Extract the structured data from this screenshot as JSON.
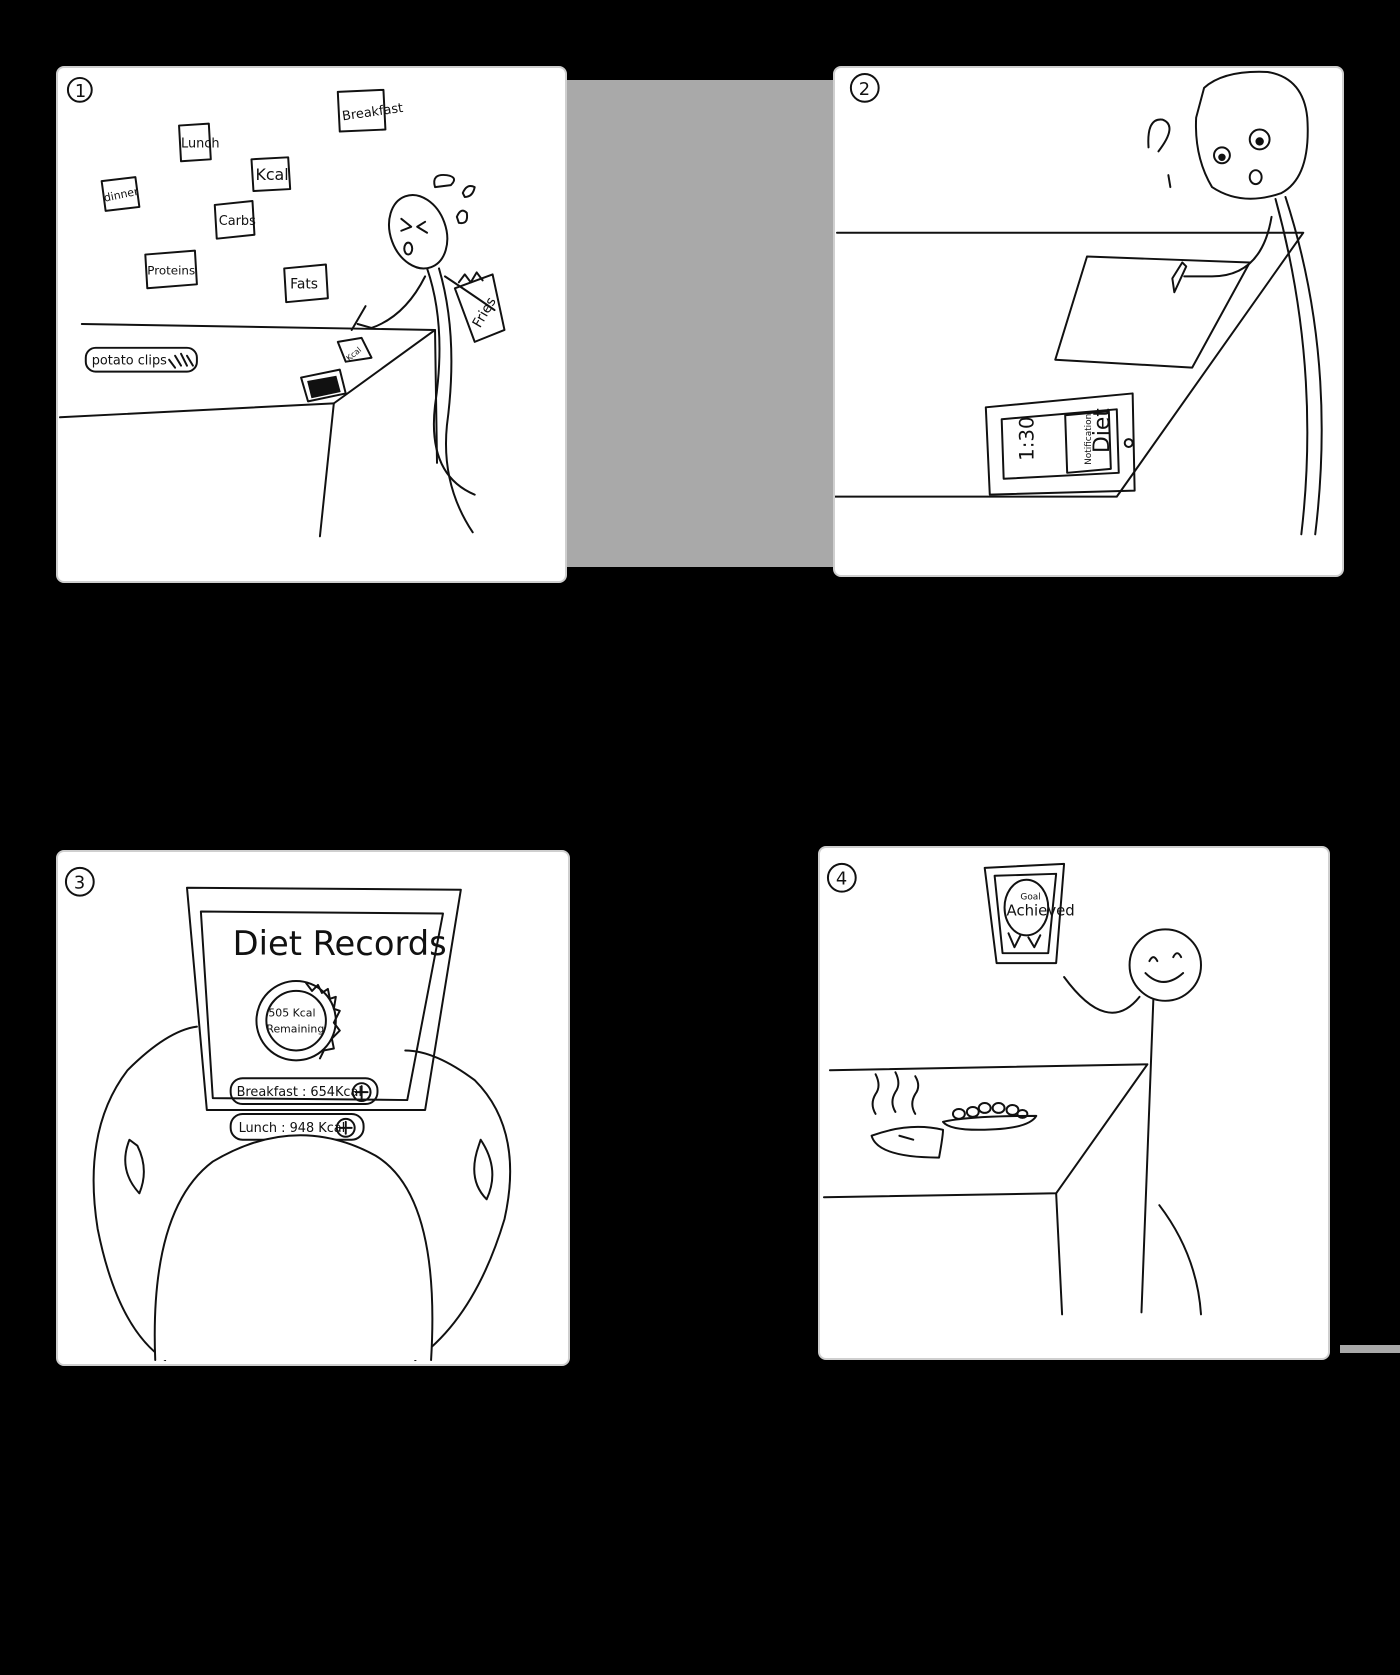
{
  "panels": [
    {
      "number": "1",
      "labels": {
        "breakfast": "Breakfast",
        "lunch": "Lunch",
        "kcal": "Kcal",
        "dinner": "dinner",
        "carbs": "Carbs",
        "proteins": "Proteins",
        "fats": "Fats",
        "potato_chips": "potato clips",
        "fries": "Fries",
        "note": "Kcal"
      }
    },
    {
      "number": "2",
      "phone": {
        "time": "1:30",
        "notification_label": "Notification",
        "notification_text": "Diet"
      }
    },
    {
      "number": "3",
      "app": {
        "title": "Diet Records",
        "ring_kcal": "505 Kcal",
        "ring_label": "Remaining",
        "rows": [
          {
            "text": "Breakfast : 654Kcal",
            "icon": "plus-circle-icon"
          },
          {
            "text": "Lunch : 948 Kcal",
            "icon": "plus-circle-icon"
          }
        ]
      }
    },
    {
      "number": "4",
      "phone": {
        "goal_small": "Goal",
        "goal_big": "Achieved"
      }
    }
  ]
}
